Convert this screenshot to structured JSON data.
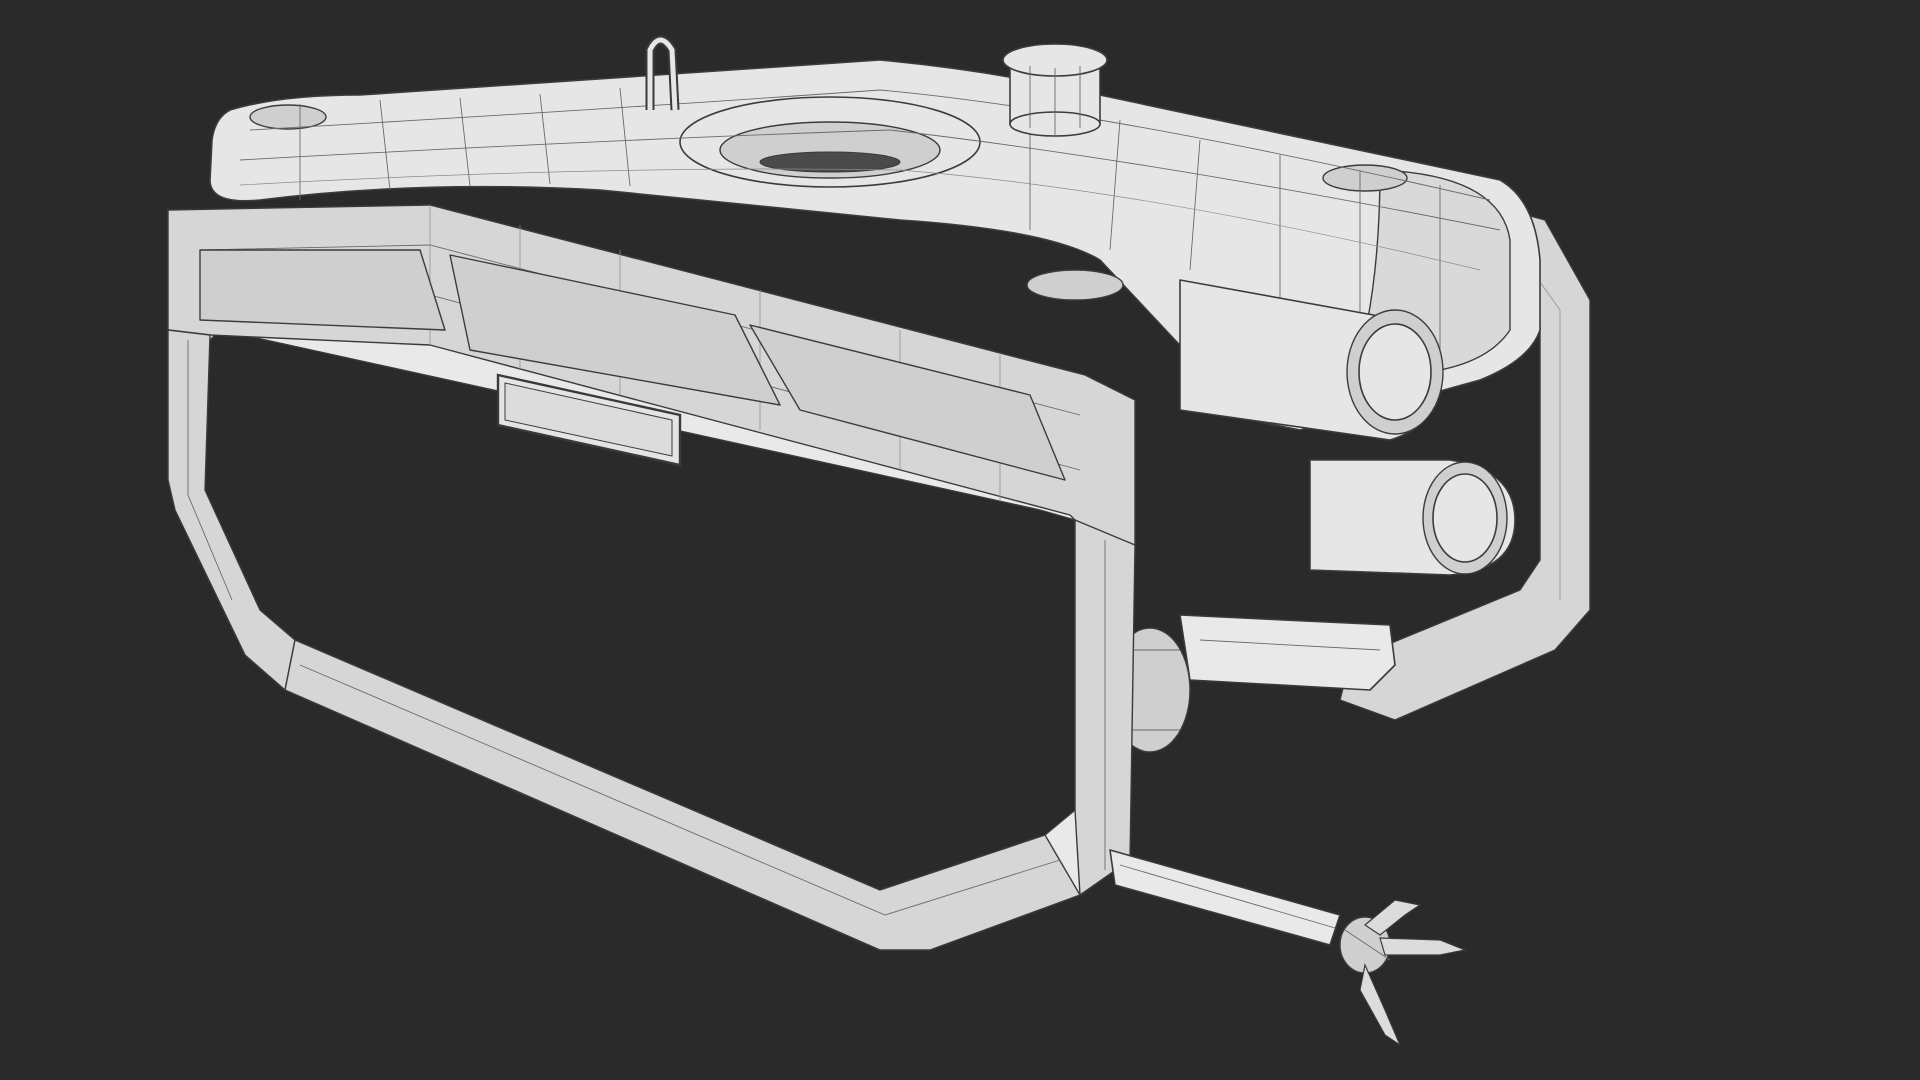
{
  "scene": {
    "background_color": "#2a2a2a",
    "model_fill_color": "#e6e6e6",
    "wire_color": "#6a6a6a",
    "subject": "rov-wireframe-render"
  }
}
